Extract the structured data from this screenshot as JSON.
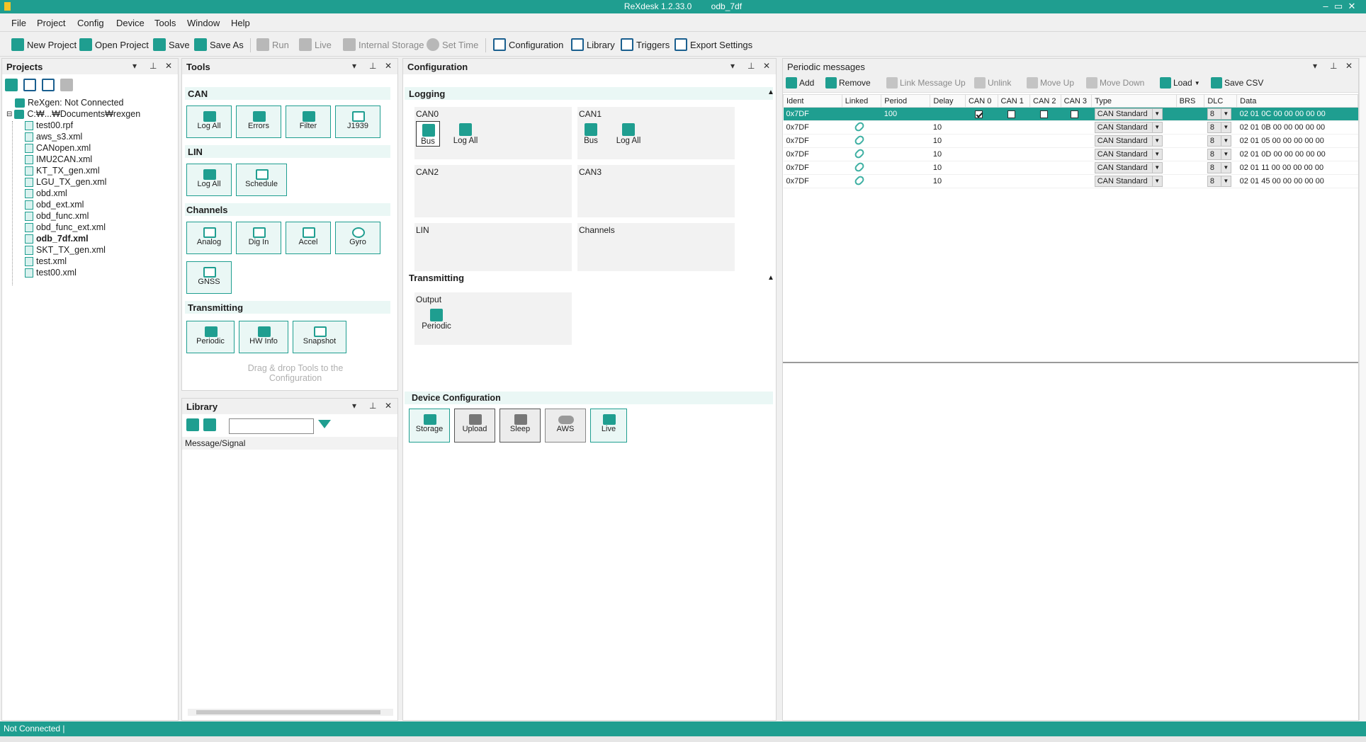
{
  "window": {
    "app_title": "ReXdesk 1.2.33.0",
    "doc_title": "odb_7df",
    "min": "–",
    "max": "▭",
    "close": "✕"
  },
  "menu": [
    "File",
    "Project",
    "Config",
    "Device",
    "Tools",
    "Window",
    "Help"
  ],
  "toolbar": {
    "new_project": "New Project",
    "open_project": "Open Project",
    "save": "Save",
    "save_as": "Save As",
    "run": "Run",
    "live": "Live",
    "internal_storage": "Internal Storage",
    "set_time": "Set Time",
    "configuration": "Configuration",
    "library": "Library",
    "triggers": "Triggers",
    "export_settings": "Export Settings"
  },
  "projects": {
    "title": "Projects",
    "root": "ReXgen: Not Connected",
    "folder": "C:₩...₩Documents₩rexgen",
    "files": [
      "test00.rpf",
      "aws_s3.xml",
      "CANopen.xml",
      "IMU2CAN.xml",
      "KT_TX_gen.xml",
      "LGU_TX_gen.xml",
      "obd.xml",
      "obd_ext.xml",
      "obd_func.xml",
      "obd_func_ext.xml",
      "odb_7df.xml",
      "SKT_TX_gen.xml",
      "test.xml",
      "test00.xml"
    ],
    "active_file": "odb_7df.xml"
  },
  "tools": {
    "title": "Tools",
    "can_title": "CAN",
    "can": [
      "Log All",
      "Errors",
      "Filter",
      "J1939"
    ],
    "lin_title": "LIN",
    "lin": [
      "Log All",
      "Schedule"
    ],
    "channels_title": "Channels",
    "channels": [
      "Analog",
      "Dig In",
      "Accel",
      "Gyro",
      "GNSS"
    ],
    "transmitting_title": "Transmitting",
    "transmitting": [
      "Periodic",
      "HW Info",
      "Snapshot"
    ],
    "hint": "Drag & drop Tools to the Configuration"
  },
  "library": {
    "title": "Library",
    "search_value": "",
    "column": "Message/Signal"
  },
  "configuration": {
    "title": "Configuration",
    "logging_title": "Logging",
    "can0": "CAN0",
    "can1": "CAN1",
    "can2": "CAN2",
    "can3": "CAN3",
    "lin": "LIN",
    "channels": "Channels",
    "bus": "Bus",
    "log_all": "Log All",
    "transmitting_title": "Transmitting",
    "output": "Output",
    "periodic": "Periodic",
    "device_title": "Device Configuration",
    "device": [
      "Storage",
      "Upload",
      "Sleep",
      "AWS",
      "Live"
    ]
  },
  "periodic": {
    "title": "Periodic messages",
    "toolbar": {
      "add": "Add",
      "remove": "Remove",
      "link": "Link Message Up",
      "unlink": "Unlink",
      "move_up": "Move Up",
      "move_down": "Move Down",
      "load": "Load",
      "save_csv": "Save CSV"
    },
    "columns": [
      "Ident",
      "Linked",
      "Period",
      "Delay",
      "CAN 0",
      "CAN 1",
      "CAN 2",
      "CAN 3",
      "Type",
      "BRS",
      "DLC",
      "Data"
    ],
    "rows": [
      {
        "ident": "0x7DF",
        "linked": false,
        "period": "100",
        "delay": "",
        "can": [
          true,
          false,
          false,
          false
        ],
        "type": "CAN Standard",
        "dlc": "8",
        "data": "02 01 0C 00 00 00 00 00"
      },
      {
        "ident": "0x7DF",
        "linked": true,
        "period": "",
        "delay": "10",
        "can": null,
        "type": "CAN Standard",
        "dlc": "8",
        "data": "02 01 0B 00 00 00 00 00"
      },
      {
        "ident": "0x7DF",
        "linked": true,
        "period": "",
        "delay": "10",
        "can": null,
        "type": "CAN Standard",
        "dlc": "8",
        "data": "02 01 05 00 00 00 00 00"
      },
      {
        "ident": "0x7DF",
        "linked": true,
        "period": "",
        "delay": "10",
        "can": null,
        "type": "CAN Standard",
        "dlc": "8",
        "data": "02 01 0D 00 00 00 00 00"
      },
      {
        "ident": "0x7DF",
        "linked": true,
        "period": "",
        "delay": "10",
        "can": null,
        "type": "CAN Standard",
        "dlc": "8",
        "data": "02 01 11 00 00 00 00 00"
      },
      {
        "ident": "0x7DF",
        "linked": true,
        "period": "",
        "delay": "10",
        "can": null,
        "type": "CAN Standard",
        "dlc": "8",
        "data": "02 01 45 00 00 00 00 00"
      }
    ]
  },
  "status": {
    "text": "Not Connected |"
  },
  "colors": {
    "accent": "#1f9e90",
    "selection": "#1f9e90"
  }
}
